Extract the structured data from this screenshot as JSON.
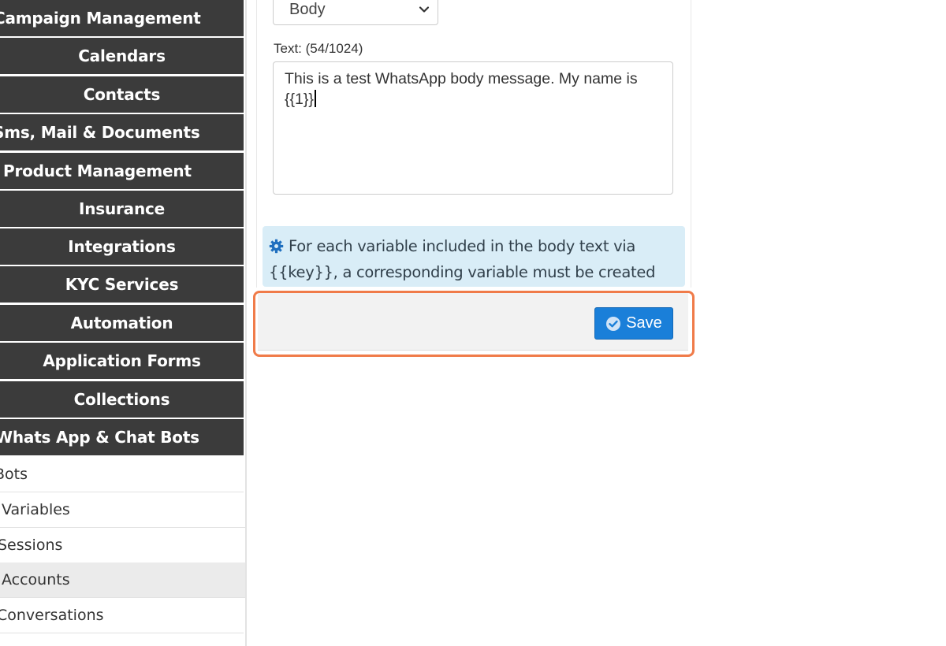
{
  "sidebar": {
    "menu": [
      {
        "label": "Campaign Management"
      },
      {
        "label": "Calendars"
      },
      {
        "label": "Contacts"
      },
      {
        "label": "Sms, Mail & Documents"
      },
      {
        "label": "Product Management"
      },
      {
        "label": "Insurance"
      },
      {
        "label": "Integrations"
      },
      {
        "label": "KYC Services"
      },
      {
        "label": "Automation"
      },
      {
        "label": "Application Forms"
      },
      {
        "label": "Collections"
      },
      {
        "label": "Whats App & Chat Bots"
      }
    ],
    "submenu": [
      {
        "label": "Bots"
      },
      {
        "label": "Variables"
      },
      {
        "label": "Sessions"
      },
      {
        "label": "Accounts"
      },
      {
        "label": "Conversations"
      }
    ],
    "active_submenu": "Accounts"
  },
  "form": {
    "select_value": "Body",
    "text_label": "Text: (54/1024)",
    "text_value_line1": "This is a test WhatsApp body message. My name is",
    "text_value_line2": "{{1}}",
    "info_line1": "For each variable included in the body text via",
    "info_line2": "{{key}}, a corresponding variable must be created",
    "save_label": "Save"
  },
  "colors": {
    "menu_bg": "#3b3b3b",
    "info_bg": "#d9edf7",
    "save_bg": "#1a7fd9",
    "highlight": "#f07b49"
  },
  "icons": {
    "info": "gear-icon",
    "save": "check-circle-icon",
    "select": "chevron-down-icon"
  }
}
